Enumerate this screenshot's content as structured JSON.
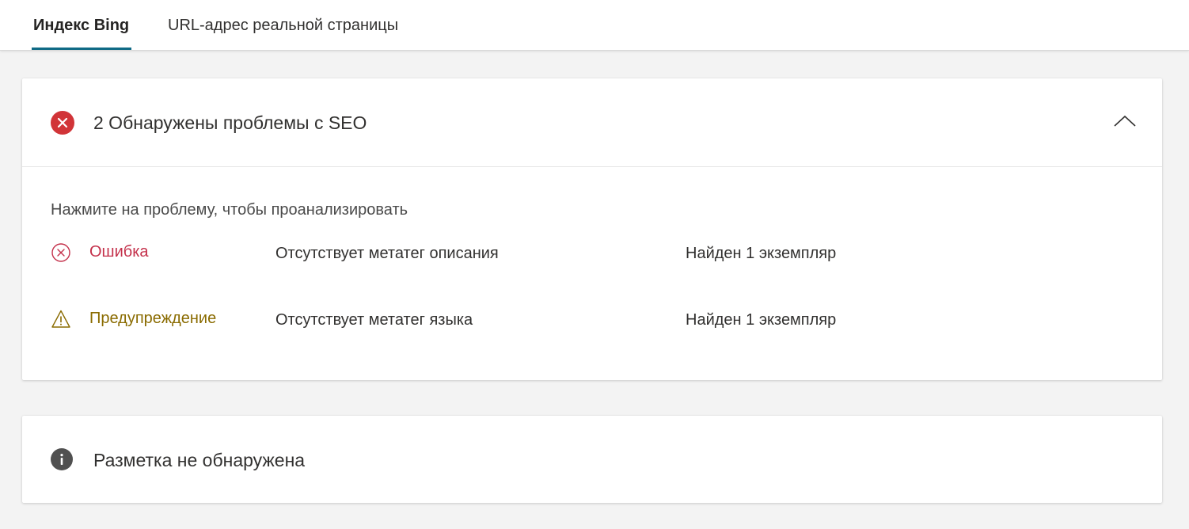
{
  "tabs": [
    {
      "label": "Индекс Bing",
      "active": true
    },
    {
      "label": "URL-адрес реальной страницы",
      "active": false
    }
  ],
  "seo_card": {
    "title": "2 Обнаружены проблемы с SEO",
    "status_icon": "error-circle-icon",
    "expanded": true,
    "hint": "Нажмите на проблему, чтобы проанализировать",
    "issues": [
      {
        "severity": "Ошибка",
        "icon": "error-outline-icon",
        "name": "Отсутствует метатег описания",
        "count": "Найден 1 экземпляр"
      },
      {
        "severity": "Предупреждение",
        "icon": "warning-triangle-icon",
        "name": "Отсутствует метатег языка",
        "count": "Найден 1 экземпляр"
      }
    ]
  },
  "markup_card": {
    "title": "Разметка не обнаружена",
    "status_icon": "info-circle-icon"
  },
  "colors": {
    "accent": "#0f6a85",
    "error": "#d13438",
    "error_text": "#c4314b",
    "warning_text": "#8a6b00",
    "background": "#f3f3f3"
  }
}
